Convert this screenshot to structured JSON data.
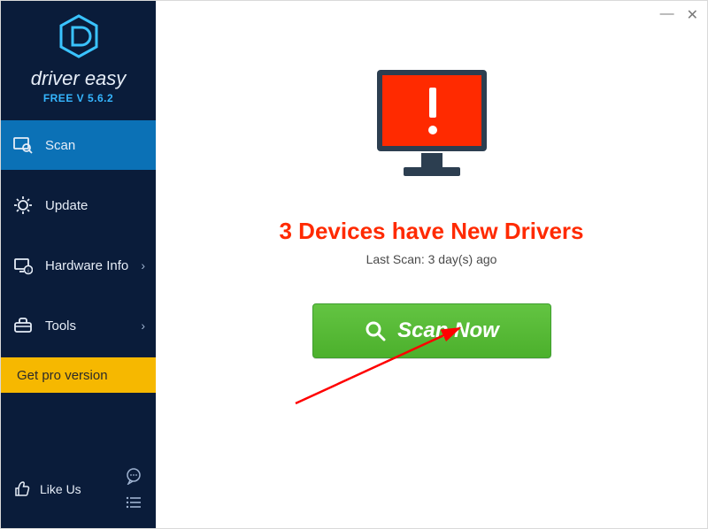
{
  "brand": {
    "name": "driver easy",
    "version": "FREE V 5.6.2"
  },
  "nav": {
    "scan": "Scan",
    "update": "Update",
    "hardware": "Hardware Info",
    "tools": "Tools"
  },
  "pro_button": "Get pro version",
  "like_us": "Like Us",
  "main": {
    "headline": "3 Devices have New Drivers",
    "last_scan": "Last Scan: 3 day(s) ago",
    "scan_button": "Scan Now"
  }
}
